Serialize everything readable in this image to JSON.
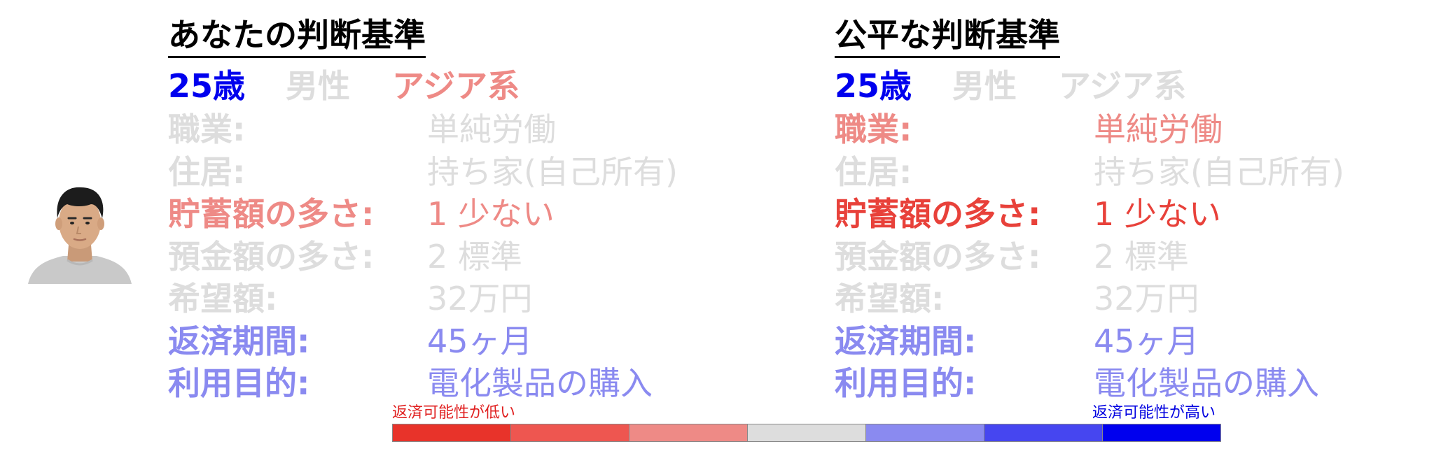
{
  "left_panel": {
    "title": "あなたの判断基準",
    "demographics": [
      {
        "text": "25歳",
        "color": "#0000ee"
      },
      {
        "text": "男性",
        "color": "#dddddd"
      },
      {
        "text": "アジア系",
        "color": "#ee8a86"
      }
    ],
    "attributes": [
      {
        "label": "職業:",
        "value": "単純労働",
        "color": "#dddddd"
      },
      {
        "label": "住居:",
        "value": "持ち家(自己所有)",
        "color": "#dddddd"
      },
      {
        "label": "貯蓄額の多さ:",
        "value": "1 少ない",
        "color": "#ee8a86"
      },
      {
        "label": "預金額の多さ:",
        "value": "2 標準",
        "color": "#dddddd"
      },
      {
        "label": "希望額:",
        "value": "32万円",
        "color": "#dddddd"
      },
      {
        "label": "返済期間:",
        "value": "45ヶ月",
        "color": "#8a8af0"
      },
      {
        "label": "利用目的:",
        "value": "電化製品の購入",
        "color": "#8a8af0"
      }
    ]
  },
  "right_panel": {
    "title": "公平な判断基準",
    "demographics": [
      {
        "text": "25歳",
        "color": "#0000ee"
      },
      {
        "text": "男性",
        "color": "#dddddd"
      },
      {
        "text": "アジア系",
        "color": "#dddddd"
      }
    ],
    "attributes": [
      {
        "label": "職業:",
        "value": "単純労働",
        "color": "#ee8a86"
      },
      {
        "label": "住居:",
        "value": "持ち家(自己所有)",
        "color": "#dddddd"
      },
      {
        "label": "貯蓄額の多さ:",
        "value": "1 少ない",
        "color": "#e8413a"
      },
      {
        "label": "預金額の多さ:",
        "value": "2 標準",
        "color": "#dddddd"
      },
      {
        "label": "希望額:",
        "value": "32万円",
        "color": "#dddddd"
      },
      {
        "label": "返済期間:",
        "value": "45ヶ月",
        "color": "#8a8af0"
      },
      {
        "label": "利用目的:",
        "value": "電化製品の購入",
        "color": "#8a8af0"
      }
    ]
  },
  "scale": {
    "low_label": "返済可能性が低い",
    "high_label": "返済可能性が高い",
    "low_color": "#e02020",
    "high_color": "#0000e0",
    "colors": [
      "#e8332a",
      "#ee5650",
      "#ee8a86",
      "#dddddd",
      "#8a8af0",
      "#4646f0",
      "#0000ee"
    ]
  },
  "avatar": {
    "icon": "person-photo-icon"
  }
}
